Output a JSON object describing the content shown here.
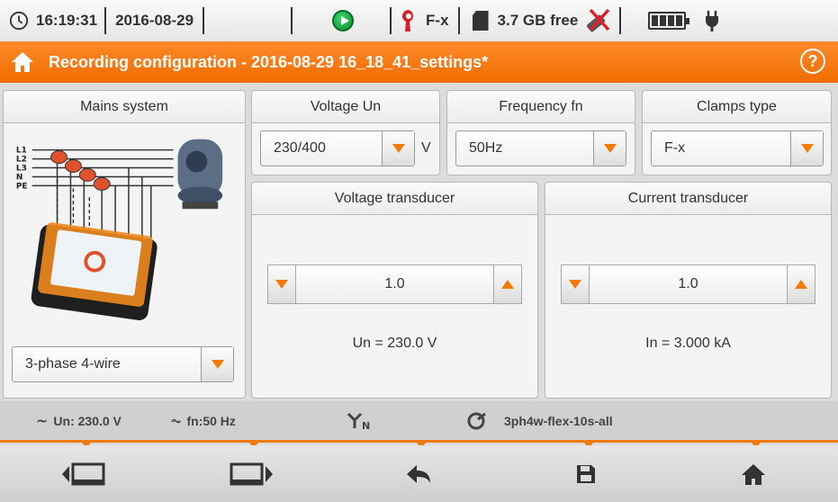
{
  "status_bar": {
    "time": "16:19:31",
    "date": "2016-08-29",
    "clamps": "F-x",
    "storage": "3.7 GB free",
    "icons": [
      "clock-icon",
      "record-play-icon",
      "clamp-icon",
      "sd-card-icon",
      "usb-disconnected-icon",
      "battery-icon",
      "power-plug-icon"
    ]
  },
  "title_bar": {
    "title": "Recording configuration - 2016-08-29 16_18_41_settings*",
    "help_label": "?"
  },
  "mains_system": {
    "header": "Mains system",
    "diagram_labels": [
      "L1",
      "L2",
      "L3",
      "N",
      "PE"
    ],
    "selected": "3-phase 4-wire"
  },
  "voltage_un": {
    "header": "Voltage Un",
    "selected": "230/400",
    "unit": "V"
  },
  "frequency_fn": {
    "header": "Frequency fn",
    "selected": "50Hz"
  },
  "clamps_type": {
    "header": "Clamps type",
    "selected": "F-x"
  },
  "voltage_transducer": {
    "header": "Voltage transducer",
    "value": "1.0",
    "readout": "Un =  230.0 V"
  },
  "current_transducer": {
    "header": "Current transducer",
    "value": "1.0",
    "readout": "In = 3.000 kA"
  },
  "info_bar": {
    "voltage": "Un: 230.0 V",
    "frequency": "fn:50 Hz",
    "profile": "3ph4w-flex-10s-all"
  },
  "bottom_bar": {
    "buttons": [
      "previous-screen",
      "next-screen",
      "back",
      "save",
      "home"
    ]
  },
  "colors": {
    "accent": "#f47a00",
    "title_bar": "#f57300"
  }
}
